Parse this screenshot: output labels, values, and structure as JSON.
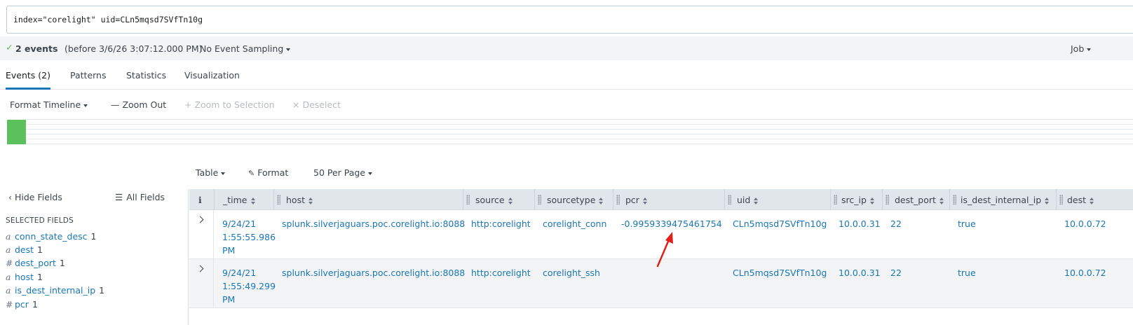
{
  "search": {
    "query": "index=\"corelight\" uid=CLn5mqsd7SVfTn10g"
  },
  "status": {
    "check": "✓",
    "events_count": "2 events",
    "events_before": "(before 3/6/26 3:07:12.000 PM)",
    "sampling": "No Event Sampling",
    "job": "Job"
  },
  "tabs": [
    {
      "label": "Events (2)"
    },
    {
      "label": "Patterns"
    },
    {
      "label": "Statistics"
    },
    {
      "label": "Visualization"
    }
  ],
  "timeline": {
    "format": "Format Timeline",
    "zoom_out": "— Zoom Out",
    "zoom_selection": "+ Zoom to Selection",
    "deselect": "× Deselect"
  },
  "results_toolbar": {
    "table": "Table",
    "format": "Format",
    "per_page": "50 Per Page"
  },
  "sidebar": {
    "hide_fields": "Hide Fields",
    "all_fields": "All Fields",
    "selected_heading": "SELECTED FIELDS",
    "fields": [
      {
        "type": "a",
        "name": "conn_state_desc",
        "count": "1"
      },
      {
        "type": "a",
        "name": "dest",
        "count": "1"
      },
      {
        "type": "#",
        "name": "dest_port",
        "count": "1"
      },
      {
        "type": "a",
        "name": "host",
        "count": "1"
      },
      {
        "type": "a",
        "name": "is_dest_internal_ip",
        "count": "1"
      },
      {
        "type": "#",
        "name": "pcr",
        "count": "1"
      }
    ]
  },
  "table": {
    "info_header": "i",
    "columns": [
      "_time",
      "host",
      "source",
      "sourcetype",
      "pcr",
      "uid",
      "src_ip",
      "dest_port",
      "is_dest_internal_ip",
      "dest"
    ],
    "rows": [
      {
        "time": "9/24/21 1:55:55.986 PM",
        "host": "splunk.silverjaguars.poc.corelight.io:8088",
        "source": "http:corelight",
        "sourcetype": "corelight_conn",
        "pcr": "-0.9959339475461754",
        "uid": "CLn5mqsd7SVfTn10g",
        "src_ip": "10.0.0.31",
        "dest_port": "22",
        "is_dest_internal_ip": "true",
        "dest": "10.0.0.72"
      },
      {
        "time": "9/24/21 1:55:49.299 PM",
        "host": "splunk.silverjaguars.poc.corelight.io:8088",
        "source": "http:corelight",
        "sourcetype": "corelight_ssh",
        "pcr": "",
        "uid": "CLn5mqsd7SVfTn10g",
        "src_ip": "10.0.0.31",
        "dest_port": "22",
        "is_dest_internal_ip": "true",
        "dest": "10.0.0.72"
      }
    ]
  },
  "colors": {
    "accent": "#1a76b6",
    "success": "#5cc05c",
    "annotation_arrow": "#e0201b"
  }
}
